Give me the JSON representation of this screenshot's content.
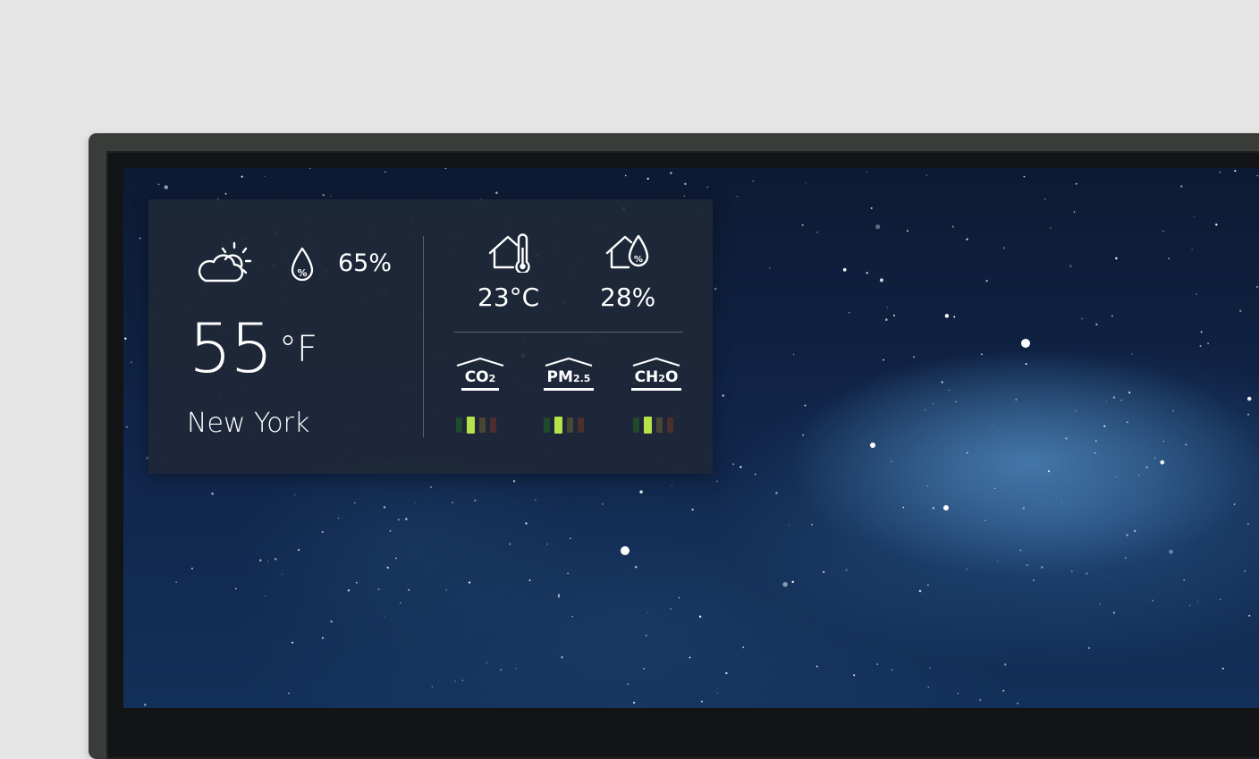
{
  "outdoor": {
    "weather_icon": "partly-cloudy-icon",
    "humidity_icon": "humidity-drop-icon",
    "humidity": "65%",
    "temperature": "55",
    "temperature_unit": "°F",
    "city": "New York"
  },
  "indoor": {
    "temperature_icon": "home-thermometer-icon",
    "temperature": "23°C",
    "humidity_icon": "home-humidity-icon",
    "humidity": "28%"
  },
  "air_quality": [
    {
      "label": "CO",
      "sub": "2",
      "icon": "home-roof-icon",
      "level": 2,
      "levels": 4
    },
    {
      "label": "PM",
      "sub": "2.5",
      "icon": "home-roof-icon",
      "level": 2,
      "levels": 4
    },
    {
      "label": "CH",
      "sub": "2",
      "suffix": "O",
      "icon": "home-roof-icon",
      "level": 2,
      "levels": 4
    }
  ],
  "colors": {
    "level_active": "#b6e34a",
    "level_1": "#1f4a2b",
    "level_3": "#4a4634",
    "level_4": "#4c2f2c",
    "panel": "#1e2838"
  }
}
